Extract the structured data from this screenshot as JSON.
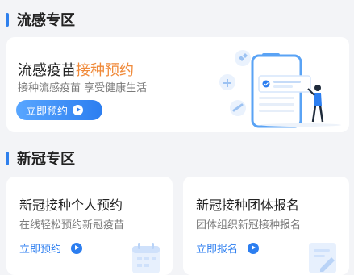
{
  "flu_section": {
    "title": "流感专区",
    "card": {
      "title_plain": "流感疫苗",
      "title_accent": "接种预约",
      "subtitle": "接种流感疫苗 享受健康生活",
      "button_label": "立即预约"
    }
  },
  "covid_section": {
    "title": "新冠专区",
    "cards": [
      {
        "title": "新冠接种个人预约",
        "subtitle": "在线轻松预约新冠疫苗",
        "link_label": "立即预约",
        "decoration_icon": "calendar-icon"
      },
      {
        "title": "新冠接种团体报名",
        "subtitle": "团体组织新冠接种报名",
        "link_label": "立即报名",
        "decoration_icon": "edit-form-icon"
      }
    ]
  },
  "colors": {
    "accent_blue": "#2c7ef0",
    "accent_orange": "#f08a3a",
    "background": "#f3f4f7"
  }
}
